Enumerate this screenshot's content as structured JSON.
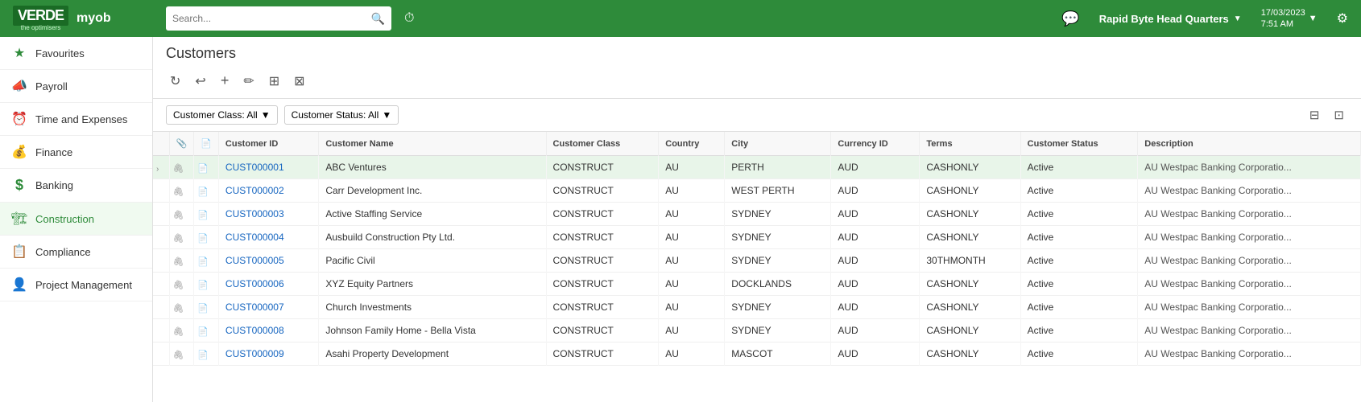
{
  "topNav": {
    "logo": "VERDE",
    "logo_sub": "the optimisers",
    "myob": "myob",
    "search_placeholder": "Search...",
    "company": "Rapid Byte Head Quarters",
    "datetime": "17/03/2023\n7:51 AM",
    "history_icon": "⏱",
    "message_icon": "💬",
    "chevron": "▼",
    "settings_icon": "⚙"
  },
  "sidebar": {
    "items": [
      {
        "id": "favourites",
        "icon": "★",
        "label": "Favourites"
      },
      {
        "id": "payroll",
        "icon": "📣",
        "label": "Payroll"
      },
      {
        "id": "time-expenses",
        "icon": "⏰",
        "label": "Time and Expenses"
      },
      {
        "id": "finance",
        "icon": "💰",
        "label": "Finance"
      },
      {
        "id": "banking",
        "icon": "$",
        "label": "Banking"
      },
      {
        "id": "construction",
        "icon": "🏗",
        "label": "Construction"
      },
      {
        "id": "compliance",
        "icon": "📋",
        "label": "Compliance"
      },
      {
        "id": "project-management",
        "icon": "👤",
        "label": "Project Management"
      }
    ]
  },
  "content": {
    "page_title": "Customers",
    "toolbar": {
      "refresh": "↻",
      "undo": "↩",
      "add": "+",
      "edit": "✏",
      "columns": "⊞",
      "export": "⊠"
    },
    "filters": {
      "customer_class_label": "Customer Class: All",
      "customer_status_label": "Customer Status: All",
      "filter_icon": "⊟",
      "columns_icon": "⊡"
    },
    "table": {
      "headers": [
        "",
        "",
        "",
        "Customer ID",
        "Customer Name",
        "Customer Class",
        "Country",
        "City",
        "Currency ID",
        "Terms",
        "Customer Status",
        "Description"
      ],
      "rows": [
        {
          "selected": true,
          "arrow": "›",
          "paperclip": "📎",
          "doc": "📄",
          "id": "CUST000001",
          "name": "ABC Ventures",
          "class": "CONSTRUCT",
          "country": "AU",
          "city": "PERTH",
          "currency": "AUD",
          "terms": "CASHONLY",
          "status": "Active",
          "description": "AU Westpac Banking Corporatio..."
        },
        {
          "selected": false,
          "arrow": "",
          "paperclip": "📎",
          "doc": "📄",
          "id": "CUST000002",
          "name": "Carr Development Inc.",
          "class": "CONSTRUCT",
          "country": "AU",
          "city": "WEST PERTH",
          "currency": "AUD",
          "terms": "CASHONLY",
          "status": "Active",
          "description": "AU Westpac Banking Corporatio..."
        },
        {
          "selected": false,
          "arrow": "",
          "paperclip": "📎",
          "doc": "📄",
          "id": "CUST000003",
          "name": "Active Staffing Service",
          "class": "CONSTRUCT",
          "country": "AU",
          "city": "SYDNEY",
          "currency": "AUD",
          "terms": "CASHONLY",
          "status": "Active",
          "description": "AU Westpac Banking Corporatio..."
        },
        {
          "selected": false,
          "arrow": "",
          "paperclip": "📎",
          "doc": "📄",
          "id": "CUST000004",
          "name": "Ausbuild Construction Pty Ltd.",
          "class": "CONSTRUCT",
          "country": "AU",
          "city": "SYDNEY",
          "currency": "AUD",
          "terms": "CASHONLY",
          "status": "Active",
          "description": "AU Westpac Banking Corporatio..."
        },
        {
          "selected": false,
          "arrow": "",
          "paperclip": "📎",
          "doc": "📄",
          "id": "CUST000005",
          "name": "Pacific Civil",
          "class": "CONSTRUCT",
          "country": "AU",
          "city": "SYDNEY",
          "currency": "AUD",
          "terms": "30THMONTH",
          "status": "Active",
          "description": "AU Westpac Banking Corporatio..."
        },
        {
          "selected": false,
          "arrow": "",
          "paperclip": "📎",
          "doc": "📄",
          "id": "CUST000006",
          "name": "XYZ Equity Partners",
          "class": "CONSTRUCT",
          "country": "AU",
          "city": "DOCKLANDS",
          "currency": "AUD",
          "terms": "CASHONLY",
          "status": "Active",
          "description": "AU Westpac Banking Corporatio..."
        },
        {
          "selected": false,
          "arrow": "",
          "paperclip": "📎",
          "doc": "📄",
          "id": "CUST000007",
          "name": "Church Investments",
          "class": "CONSTRUCT",
          "country": "AU",
          "city": "SYDNEY",
          "currency": "AUD",
          "terms": "CASHONLY",
          "status": "Active",
          "description": "AU Westpac Banking Corporatio..."
        },
        {
          "selected": false,
          "arrow": "",
          "paperclip": "📎",
          "doc": "📄",
          "id": "CUST000008",
          "name": "Johnson Family Home - Bella Vista",
          "class": "CONSTRUCT",
          "country": "AU",
          "city": "SYDNEY",
          "currency": "AUD",
          "terms": "CASHONLY",
          "status": "Active",
          "description": "AU Westpac Banking Corporatio..."
        },
        {
          "selected": false,
          "arrow": "",
          "paperclip": "📎",
          "doc": "📄",
          "id": "CUST000009",
          "name": "Asahi Property Development",
          "class": "CONSTRUCT",
          "country": "AU",
          "city": "MASCOT",
          "currency": "AUD",
          "terms": "CASHONLY",
          "status": "Active",
          "description": "AU Westpac Banking Corporatio..."
        }
      ]
    }
  },
  "colors": {
    "primary_green": "#2e8b3a",
    "selected_row_bg": "#e8f5e9",
    "link_blue": "#1565c0"
  }
}
